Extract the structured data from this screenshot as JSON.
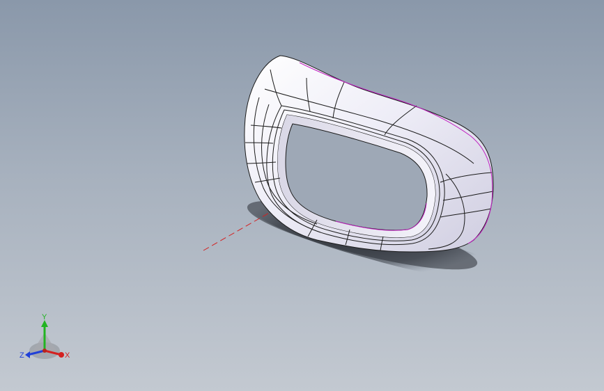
{
  "viewport": {
    "background_top": "#8a98aa",
    "background_bottom": "#c3c9d1"
  },
  "model": {
    "part_color": "#e7e5f2",
    "edge_color": "#1a1a1a",
    "silhouette_color": "#c020c0",
    "centerline_color": "#d42020",
    "shadow_color": "#2e3238"
  },
  "triad": {
    "y_label": "Y",
    "x_label": "X",
    "z_label": "Z",
    "y_color": "#22b422",
    "x_color": "#d42020",
    "z_color": "#2040d8"
  }
}
